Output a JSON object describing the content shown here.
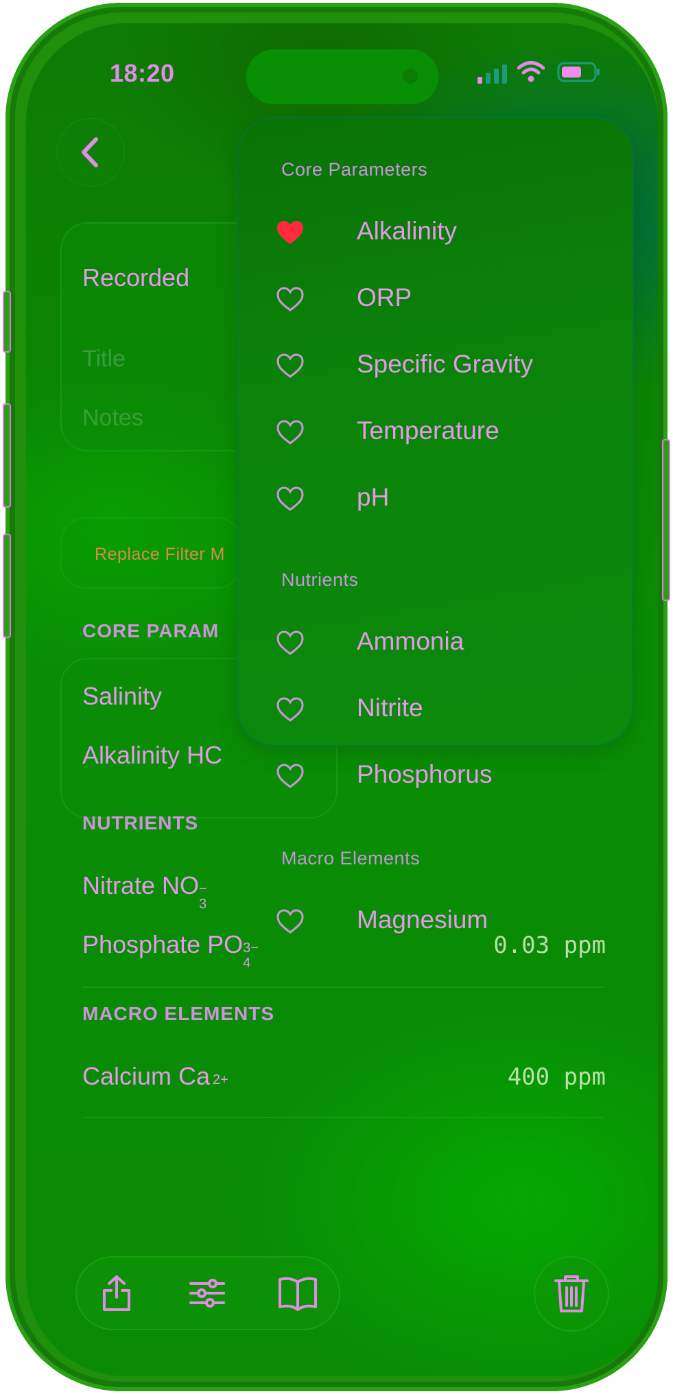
{
  "status_bar": {
    "time": "18:20"
  },
  "form": {
    "recorded_label": "Recorded",
    "title_placeholder": "Title",
    "notes_placeholder": "Notes",
    "filter_chip": "Replace Filter M"
  },
  "sections": {
    "core": {
      "header": "CORE PARAM",
      "rows": [
        {
          "name": "Salinity"
        },
        {
          "name": "Alkalinity  HC"
        }
      ]
    },
    "nutrients": {
      "header": "NUTRIENTS",
      "rows": [
        {
          "name": "Nitrate  NO",
          "sup": "−",
          "sub": "3",
          "value": ""
        },
        {
          "name": "Phosphate  PO",
          "sup": "3−",
          "sub": "4",
          "value": "0.03 ppm"
        }
      ]
    },
    "macro": {
      "header": "MACRO ELEMENTS",
      "rows": [
        {
          "name": "Calcium  Ca",
          "sup": "2+",
          "value": "400 ppm"
        }
      ]
    }
  },
  "menu": {
    "sections": [
      {
        "title": "Core Parameters",
        "items": [
          {
            "label": "Alkalinity",
            "favorite": true
          },
          {
            "label": "ORP",
            "favorite": false
          },
          {
            "label": "Specific Gravity",
            "favorite": false
          },
          {
            "label": "Temperature",
            "favorite": false
          },
          {
            "label": "pH",
            "favorite": false
          }
        ]
      },
      {
        "title": "Nutrients",
        "items": [
          {
            "label": "Ammonia",
            "favorite": false
          },
          {
            "label": "Nitrite",
            "favorite": false
          },
          {
            "label": "Phosphorus",
            "favorite": false
          }
        ]
      },
      {
        "title": "Macro Elements",
        "items": [
          {
            "label": "Magnesium",
            "favorite": false
          }
        ]
      }
    ]
  },
  "colors": {
    "accent": "#e39ae8",
    "favorite": "#ff2a3c",
    "value": "#b8e0a8"
  },
  "icons": {
    "back": "chevron-left-icon",
    "share": "share-icon",
    "sliders": "sliders-icon",
    "book": "book-icon",
    "trash": "trash-icon",
    "heart": "heart-icon"
  }
}
